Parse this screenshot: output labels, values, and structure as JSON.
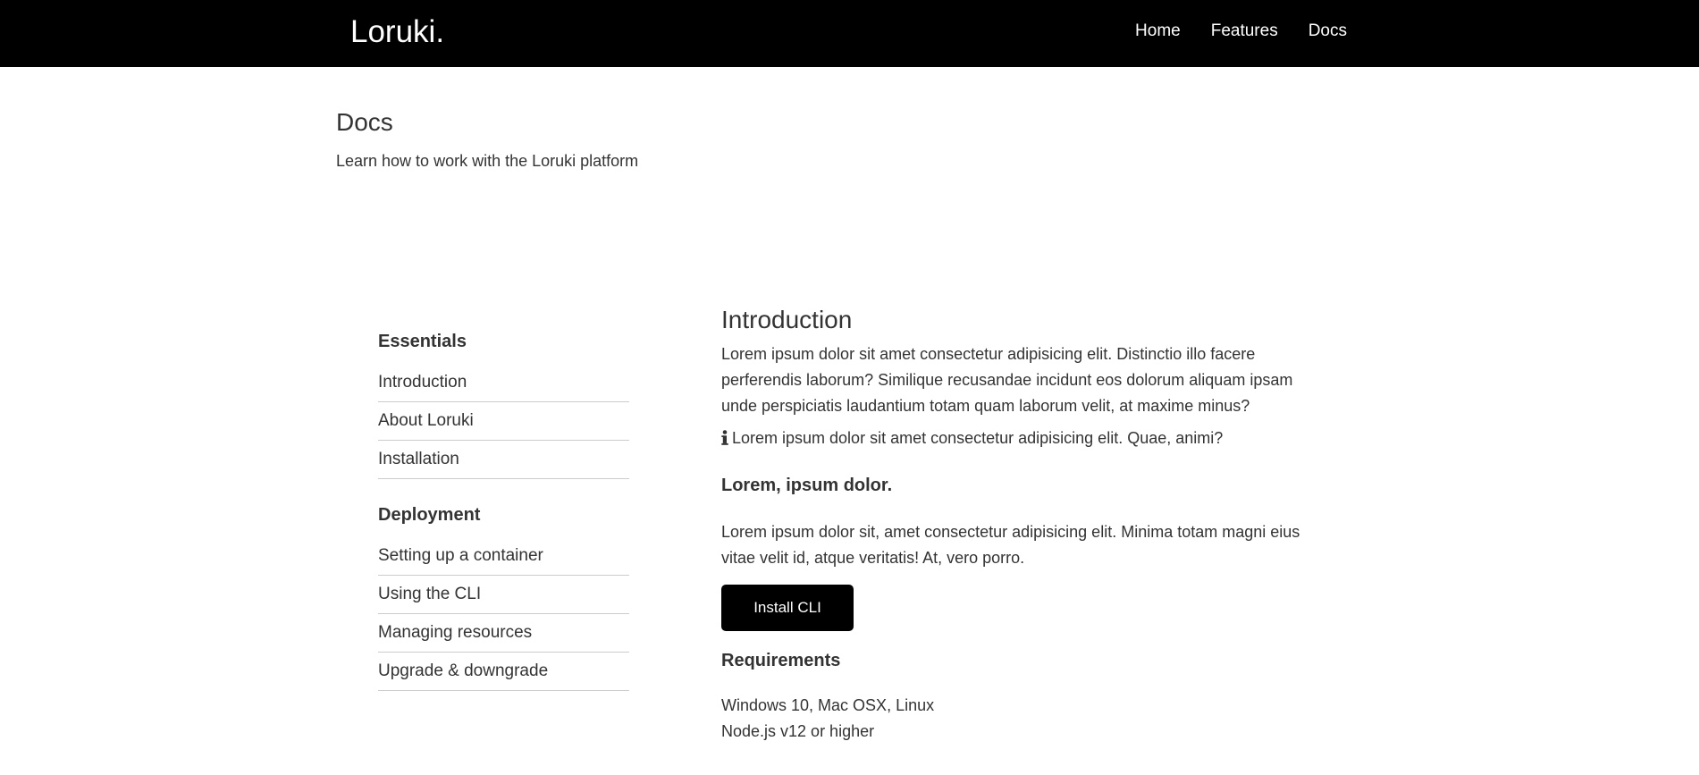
{
  "nav": {
    "logo": "Loruki.",
    "links": [
      "Home",
      "Features",
      "Docs"
    ]
  },
  "header": {
    "title": "Docs",
    "subtitle": "Learn how to work with the Loruki platform"
  },
  "sidebar": {
    "sections": [
      {
        "heading": "Essentials",
        "items": [
          "Introduction",
          "About Loruki",
          "Installation"
        ]
      },
      {
        "heading": "Deployment",
        "items": [
          "Setting up a container",
          "Using the CLI",
          "Managing resources",
          "Upgrade & downgrade"
        ]
      }
    ]
  },
  "content": {
    "title": "Introduction",
    "intro_lines": [
      "Lorem ipsum dolor sit amet consectetur adipisicing elit. Distinctio illo facere",
      "perferendis laborum? Similique recusandae incidunt eos dolorum aliquam ipsam",
      "unde perspiciatis laudantium totam quam laborum velit, at maxime minus?"
    ],
    "info_icon": "info-icon",
    "info_text": "Lorem ipsum dolor sit amet consectetur adipisicing elit. Quae, animi?",
    "subheading": "Lorem, ipsum dolor.",
    "body_lines": [
      "Lorem ipsum dolor sit, amet consectetur adipisicing elit. Minima totam magni eius",
      "vitae velit id, atque veritatis! At, vero porro."
    ],
    "button_label": "Install CLI",
    "requirements_heading": "Requirements",
    "requirements": [
      "Windows 10, Mac OSX, Linux",
      "Node.js v12 or higher"
    ]
  },
  "colors": {
    "navbar_bg": "#000000",
    "button_bg": "#000000",
    "text": "#333333",
    "divider": "#cccccc"
  }
}
